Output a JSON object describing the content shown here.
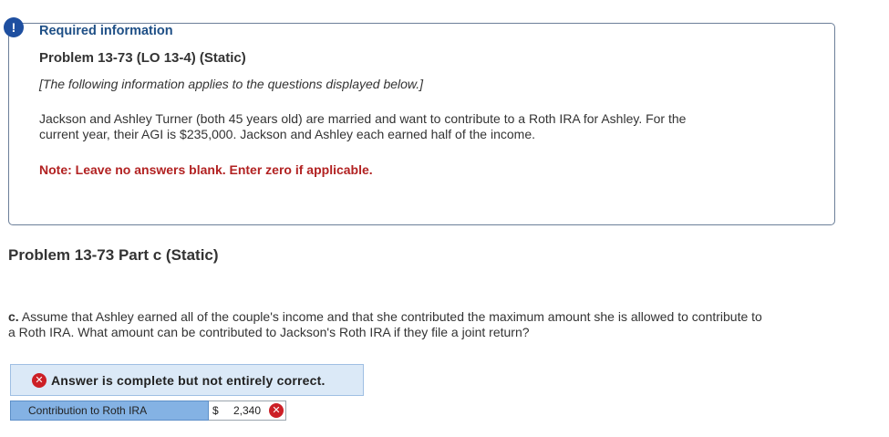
{
  "alert": {
    "icon_glyph": "!",
    "icon_name": "alert-icon",
    "color": "#1e4fa0"
  },
  "info": {
    "heading": "Required information",
    "problem_title": "Problem 13-73 (LO 13-4) (Static)",
    "applies_text": "[The following information applies to the questions displayed below.]",
    "scenario_line1": "Jackson and Ashley Turner (both 45 years old) are married and want to contribute to a Roth IRA for Ashley. For the",
    "scenario_line2": "current year, their AGI is $235,000. Jackson and Ashley each earned half of the income.",
    "note": "Note: Leave no answers blank. Enter zero if applicable."
  },
  "part": {
    "title": "Problem 13-73 Part c (Static)",
    "question_prefix": "c.",
    "question_line1": "Assume that Ashley earned all of the couple's income and that she contributed the maximum amount she is allowed to contribute to",
    "question_line2": "a Roth IRA. What amount can be contributed to Jackson's Roth IRA if they file a joint return?"
  },
  "answer": {
    "status_icon": "x-circle-icon",
    "status_glyph": "✕",
    "status_text": "Answer is complete but not entirely correct.",
    "row_label": "Contribution to Roth IRA",
    "currency": "$",
    "value": "2,340",
    "incorrect_color": "#cc1f26"
  }
}
